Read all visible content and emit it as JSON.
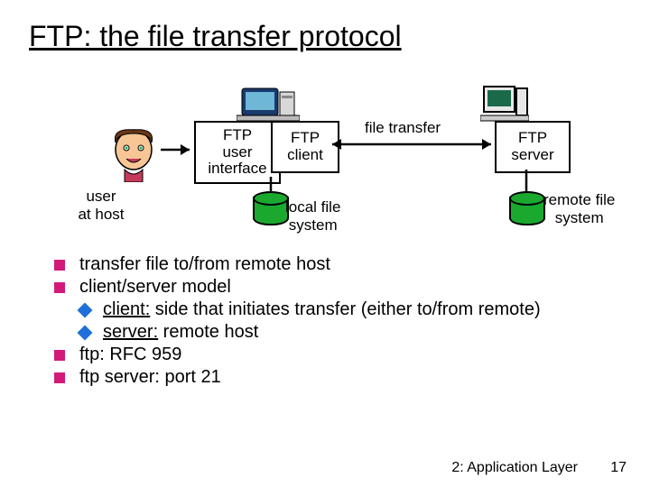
{
  "title": "FTP: the file transfer protocol",
  "diagram": {
    "user_at_host": "user\nat host",
    "ftp_ui_l1": "FTP",
    "ftp_ui_l2": "user",
    "ftp_ui_l3": "interface",
    "ftp_client_l1": "FTP",
    "ftp_client_l2": "client",
    "file_transfer": "file transfer",
    "ftp_server_l1": "FTP",
    "ftp_server_l2": "server",
    "local_fs_l1": "local file",
    "local_fs_l2": "system",
    "remote_fs_l1": "remote file",
    "remote_fs_l2": "system"
  },
  "bullets": {
    "b1": "transfer file to/from remote host",
    "b2": "client/server model",
    "b2a_label": "client:",
    "b2a_rest": " side that initiates transfer (either to/from remote)",
    "b2b_label": "server:",
    "b2b_rest": " remote host",
    "b3": "ftp: RFC 959",
    "b4": "ftp server: port 21"
  },
  "footer": {
    "chapter": "2: Application Layer",
    "page": "17"
  }
}
